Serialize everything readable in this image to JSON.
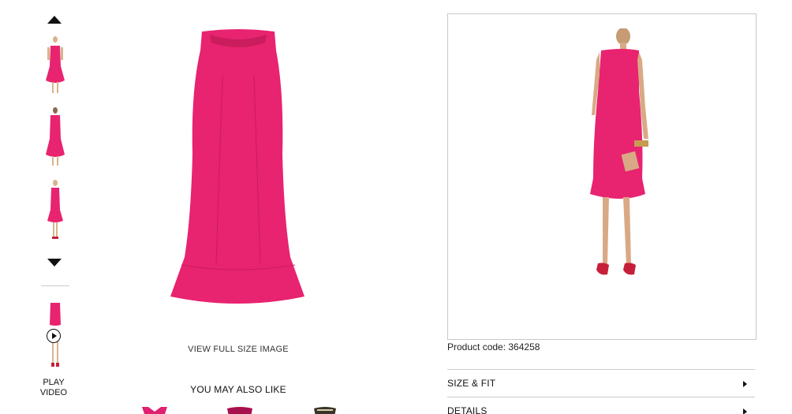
{
  "gallery": {
    "thumbnails": [
      {
        "label": "Front view"
      },
      {
        "label": "Back view"
      },
      {
        "label": "Side view"
      }
    ],
    "video": {
      "label": "PLAY VIDEO"
    }
  },
  "main": {
    "view_full_label": "VIEW FULL SIZE IMAGE",
    "you_may_also_like": "YOU MAY ALSO LIKE"
  },
  "product": {
    "code": "Product code: 364258",
    "dress_color": "#e8236f"
  },
  "accordion": {
    "items": [
      {
        "label": "SIZE & FIT"
      },
      {
        "label": "DETAILS"
      }
    ]
  }
}
